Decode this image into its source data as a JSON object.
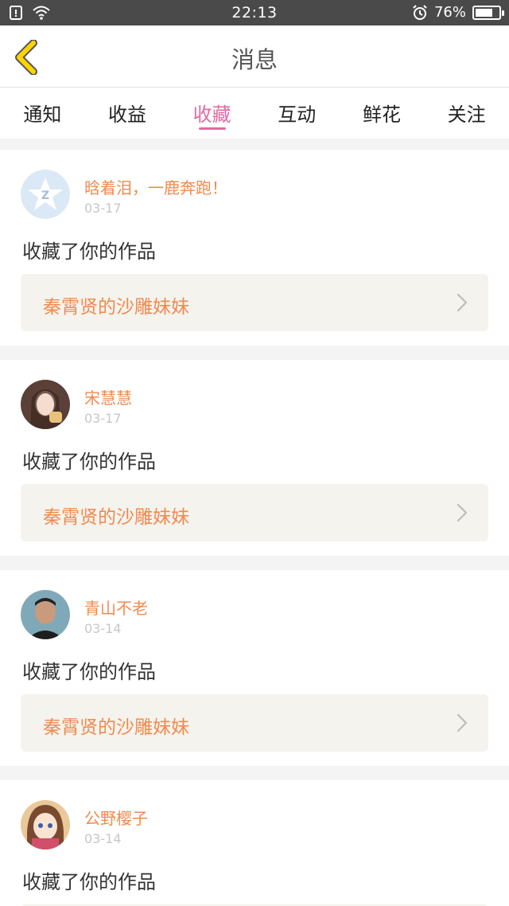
{
  "status_bar": {
    "time": "22:13",
    "battery": "76%",
    "battery_level": 0.76,
    "icons": [
      "notification-icon",
      "wifi-icon",
      "alarm-icon",
      "battery-icon"
    ]
  },
  "header": {
    "title": "消息",
    "back_icon": "chevron-left-icon",
    "back_color": "#ffd400"
  },
  "tabs": [
    {
      "label": "通知",
      "active": false
    },
    {
      "label": "收益",
      "active": false
    },
    {
      "label": "收藏",
      "active": true
    },
    {
      "label": "互动",
      "active": false
    },
    {
      "label": "鲜花",
      "active": false
    },
    {
      "label": "关注",
      "active": false
    }
  ],
  "colors": {
    "accent_pink": "#e16aa2",
    "name_orange": "#f08a50",
    "work_bg": "#f5f3ed"
  },
  "messages": [
    {
      "name": "晗着泪，一鹿奔跑！",
      "date": "03-17",
      "action": "收藏了你的作品",
      "work": "秦霄贤的沙雕妹妹"
    },
    {
      "name": "宋慧慧",
      "date": "03-17",
      "action": "收藏了你的作品",
      "work": "秦霄贤的沙雕妹妹"
    },
    {
      "name": "青山不老",
      "date": "03-14",
      "action": "收藏了你的作品",
      "work": "秦霄贤的沙雕妹妹"
    },
    {
      "name": "公野樱子",
      "date": "03-14",
      "action": "收藏了你的作品",
      "work": ""
    }
  ]
}
